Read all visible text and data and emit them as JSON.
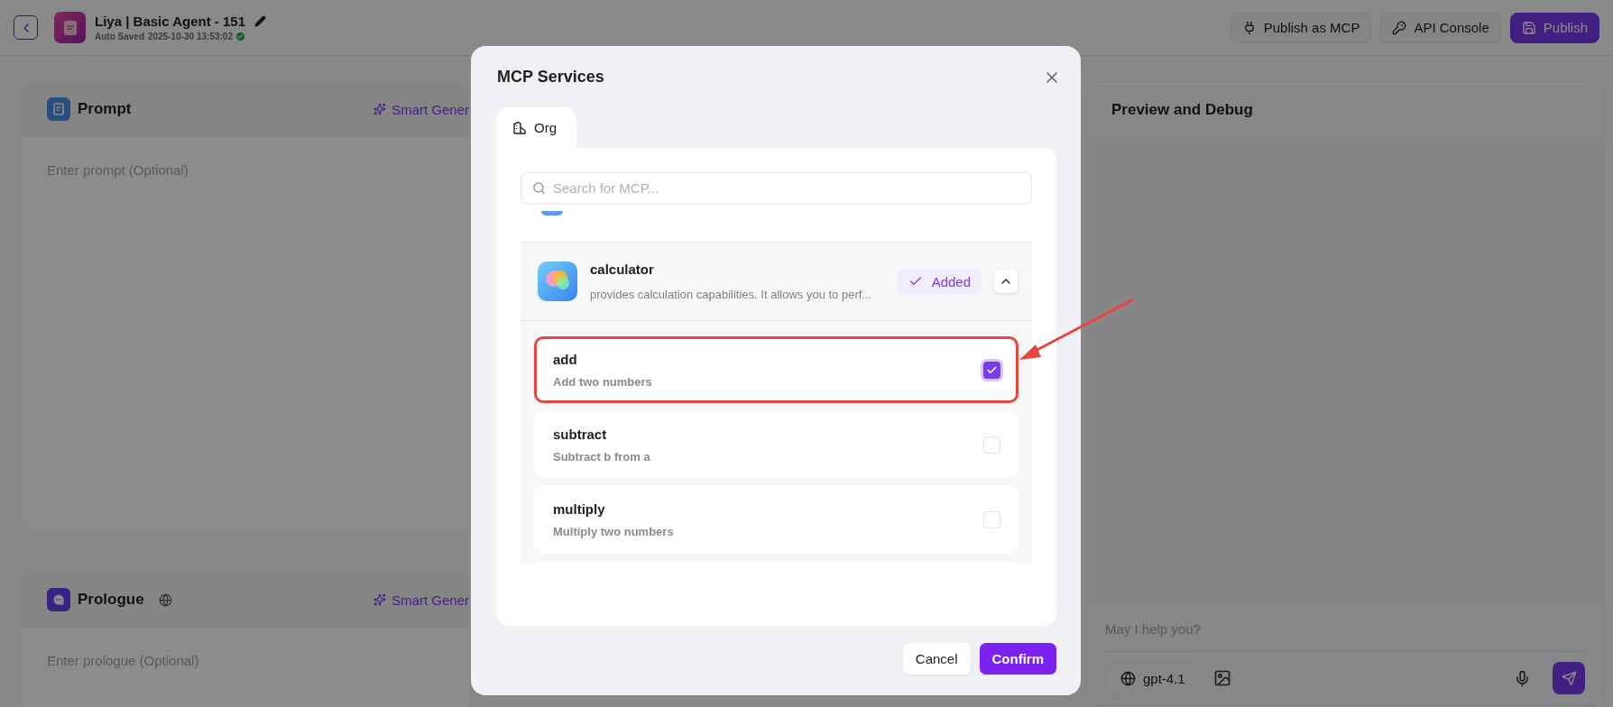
{
  "header": {
    "title": "Liya | Basic Agent - 151",
    "save_status": "Auto Saved",
    "saved_at": "2025-10-30 13:53:02",
    "saved": true,
    "actions": [
      {
        "label": "Publish as MCP",
        "kind": "plug"
      },
      {
        "label": "API Console",
        "kind": "key"
      },
      {
        "label": "Publish",
        "kind": "primary"
      }
    ]
  },
  "sections": [
    {
      "title": "Prompt",
      "kind": "prompt",
      "action": "Smart Gener",
      "placeholder": "Enter prompt (Optional)"
    },
    {
      "title": "Prologue",
      "kind": "prologue",
      "action": "Smart Gener",
      "placeholder": "Enter prologue (Optional)"
    }
  ],
  "preview": {
    "title": "Preview and Debug",
    "placeholder": "May I help you?",
    "model": "gpt-4.1"
  },
  "dialog": {
    "title": "MCP Services",
    "tabs": [
      {
        "label": "Org",
        "selected": true
      }
    ],
    "search": {
      "placeholder": "Search for MCP..."
    },
    "services": [
      {
        "name": "calculator",
        "description": "provides calculation capabilities. It allows you to perf...",
        "status": "Added",
        "added": true,
        "expanded": true,
        "tools": [
          {
            "name": "add",
            "description": "Add two numbers",
            "checked": true,
            "highlighted": true
          },
          {
            "name": "subtract",
            "description": "Subtract b from a",
            "checked": false,
            "highlighted": false
          },
          {
            "name": "multiply",
            "description": "Multiply two numbers",
            "checked": false,
            "highlighted": false
          }
        ]
      }
    ],
    "buttons": [
      {
        "label": "Cancel",
        "kind": "secondary"
      },
      {
        "label": "Confirm",
        "kind": "primary"
      }
    ]
  }
}
